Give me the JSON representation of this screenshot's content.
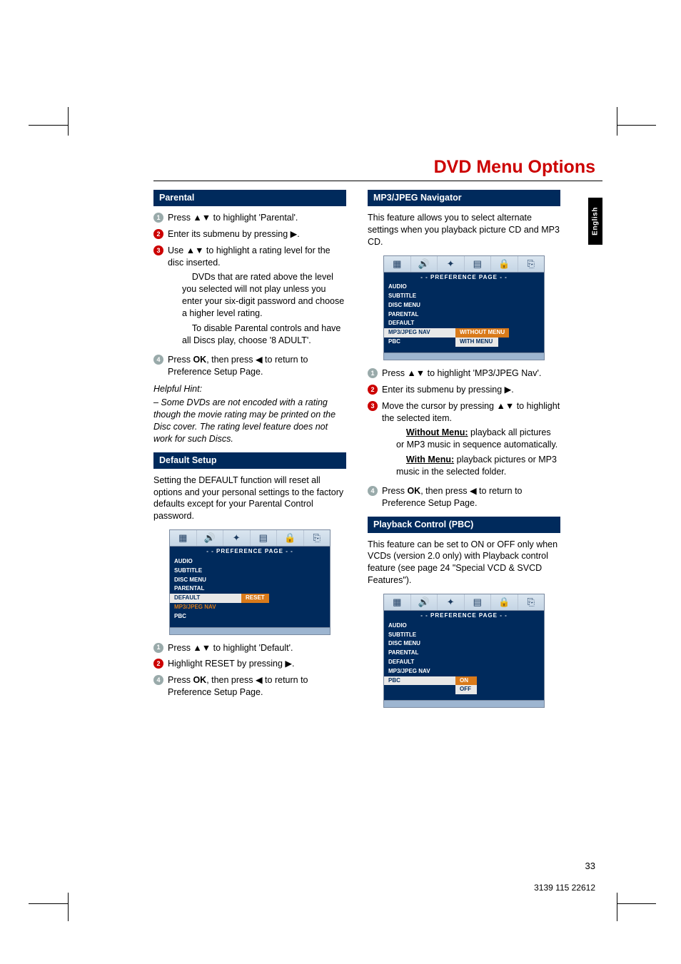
{
  "page_title": "DVD Menu Options",
  "side_tab": "English",
  "page_number": "33",
  "footer_code": "3139 115 22612",
  "col_left": {
    "section1": {
      "title": "Parental"
    },
    "s1_steps": [
      "Press 34 to highlight 'Parental'.",
      "Enter its submenu by pressing 2.",
      "Use 34 to highlight a rating level for the disc inserted."
    ],
    "s1_p1": "DVDs that are rated above the level you selected will not play unless you enter your six-digit password and choose a higher level rating.",
    "s1_p2": "To disable Parental controls and have all Discs play, choose '8 ADULT'.",
    "s1_step4": "Press OK, then press 1 to return to Preference Setup Page.",
    "hint_title": "Helpful Hint:",
    "hint": "– Some DVDs are not encoded with a rating though the movie rating may be printed on the Disc cover. The rating level feature does not work for such Discs.",
    "section2": {
      "title": "Default Setup"
    },
    "s2_intro": "Setting the DEFAULT function will reset all options and your personal settings to the factory defaults except for your Parental Control password.",
    "s2_steps": [
      "Press 34 to highlight 'Default'.",
      "Highlight RESET by pressing 2.",
      "Press OK, then press 1 to return to Preference Setup Page."
    ]
  },
  "col_right": {
    "section1": {
      "title": "MP3/JPEG Navigator"
    },
    "s1_intro": "This feature allows you to select alternate settings when you playback picture CD and MP3 CD.",
    "s1_steps": [
      "Press 34 to highlight 'MP3/JPEG Nav'.",
      "Enter its submenu by pressing 2.",
      "Move the cursor by pressing 34 to highlight the selected item."
    ],
    "s1_wm_label": "Without Menu:",
    "s1_wm_text": " playback all pictures or MP3 music in sequence automatically.",
    "s1_m_label": "With Menu:",
    "s1_m_text": " playback pictures or MP3 music in the selected folder.",
    "s1_step4": "Press OK, then press 1 to return to Preference Setup Page.",
    "section2": {
      "title": "Playback Control (PBC)"
    },
    "s2_intro": "This feature can be set to ON or OFF only when VCDs (version 2.0 only) with Playback control feature (see page 24 \"Special VCD & SVCD Features\")."
  },
  "menu": {
    "header": "- -   PREFERENCE  PAGE   - -",
    "items": [
      "AUDIO",
      "SUBTITLE",
      "DISC MENU",
      "PARENTAL",
      "DEFAULT",
      "MP3/JPEG NAV",
      "PBC"
    ],
    "reset": "RESET",
    "without": "WITHOUT MENU",
    "with": "WITH MENU",
    "on": "ON",
    "off": "OFF"
  }
}
